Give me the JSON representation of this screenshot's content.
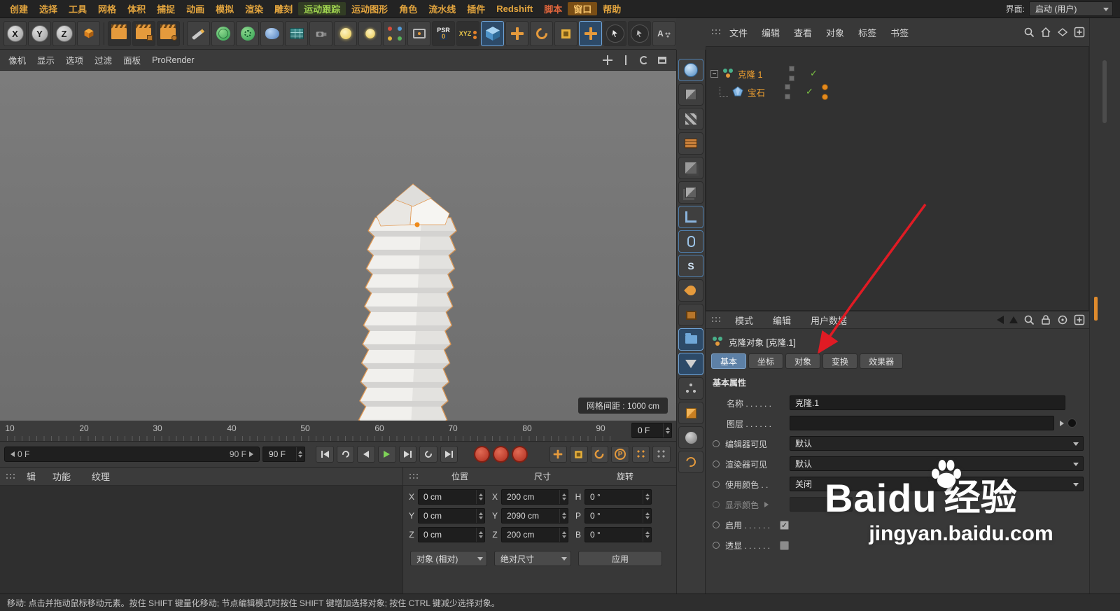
{
  "menubar": {
    "items": [
      "创建",
      "选择",
      "工具",
      "网格",
      "体积",
      "捕捉",
      "动画",
      "模拟",
      "渲染",
      "雕刻",
      "运动跟踪",
      "运动图形",
      "角色",
      "流水线",
      "插件",
      "Redshift",
      "脚本",
      "窗口",
      "帮助"
    ],
    "interface_label": "界面:",
    "interface_value": "启动 (用户)"
  },
  "toolbar": {
    "axis": [
      "X",
      "Y",
      "Z"
    ],
    "psr_label": "PSR",
    "psr_zero": "0",
    "xyz_label": "XYZ"
  },
  "viewport": {
    "menu": [
      "像机",
      "显示",
      "选项",
      "过滤",
      "面板",
      "ProRender"
    ],
    "grid_label": "网格间距 : 1000 cm"
  },
  "timeline": {
    "ticks": [
      "10",
      "20",
      "30",
      "40",
      "50",
      "60",
      "70",
      "80",
      "90"
    ],
    "frame_field": "0 F",
    "range_start": "0 F",
    "range_end": "90 F",
    "end_field": "90 F"
  },
  "materials": {
    "partial_menu": "辑",
    "menus": [
      "功能",
      "纹理"
    ]
  },
  "coords": {
    "headers": [
      "位置",
      "尺寸",
      "旋转"
    ],
    "position": [
      {
        "axis": "X",
        "value": "0 cm"
      },
      {
        "axis": "Y",
        "value": "0 cm"
      },
      {
        "axis": "Z",
        "value": "0 cm"
      }
    ],
    "size": [
      {
        "axis": "X",
        "value": "200 cm"
      },
      {
        "axis": "Y",
        "value": "2090 cm"
      },
      {
        "axis": "Z",
        "value": "200 cm"
      }
    ],
    "rotation": [
      {
        "axis": "H",
        "value": "0 °"
      },
      {
        "axis": "P",
        "value": "0 °"
      },
      {
        "axis": "B",
        "value": "0 °"
      }
    ],
    "mode_dropdown": "对象 (相对)",
    "size_dropdown": "绝对尺寸",
    "apply_button": "应用"
  },
  "object_manager": {
    "menus": [
      "文件",
      "编辑",
      "查看",
      "对象",
      "标签",
      "书签"
    ],
    "objects": [
      {
        "name": "克隆 1"
      },
      {
        "name": "宝石"
      }
    ]
  },
  "attributes": {
    "menus": [
      "模式",
      "编辑",
      "用户数据"
    ],
    "title": "克隆对象 [克隆.1]",
    "tabs": [
      "基本",
      "坐标",
      "对象",
      "变换",
      "效果器"
    ],
    "section": "基本属性",
    "name_label": "名称 . . . . . .",
    "name_value": "克隆.1",
    "layer_label": "图层 . . . . . .",
    "dropdown_rows": [
      {
        "label": "编辑器可见",
        "value": "默认"
      },
      {
        "label": "渲染器可见",
        "value": "默认"
      },
      {
        "label": "使用颜色 . .",
        "value": "关闭"
      }
    ],
    "display_color_label": "显示颜色",
    "enable_label": "启用 . . . . . .",
    "xray_label": "透显 . . . . . ."
  },
  "statusbar": {
    "text": "移动: 点击并拖动鼠标移动元素。按住 SHIFT 键量化移动; 节点编辑模式时按住 SHIFT 键增加选择对象; 按住 CTRL 键减少选择对象。"
  },
  "watermark": {
    "brand": "Baidu",
    "jingyan": "经验",
    "url": "jingyan.baidu.com"
  }
}
